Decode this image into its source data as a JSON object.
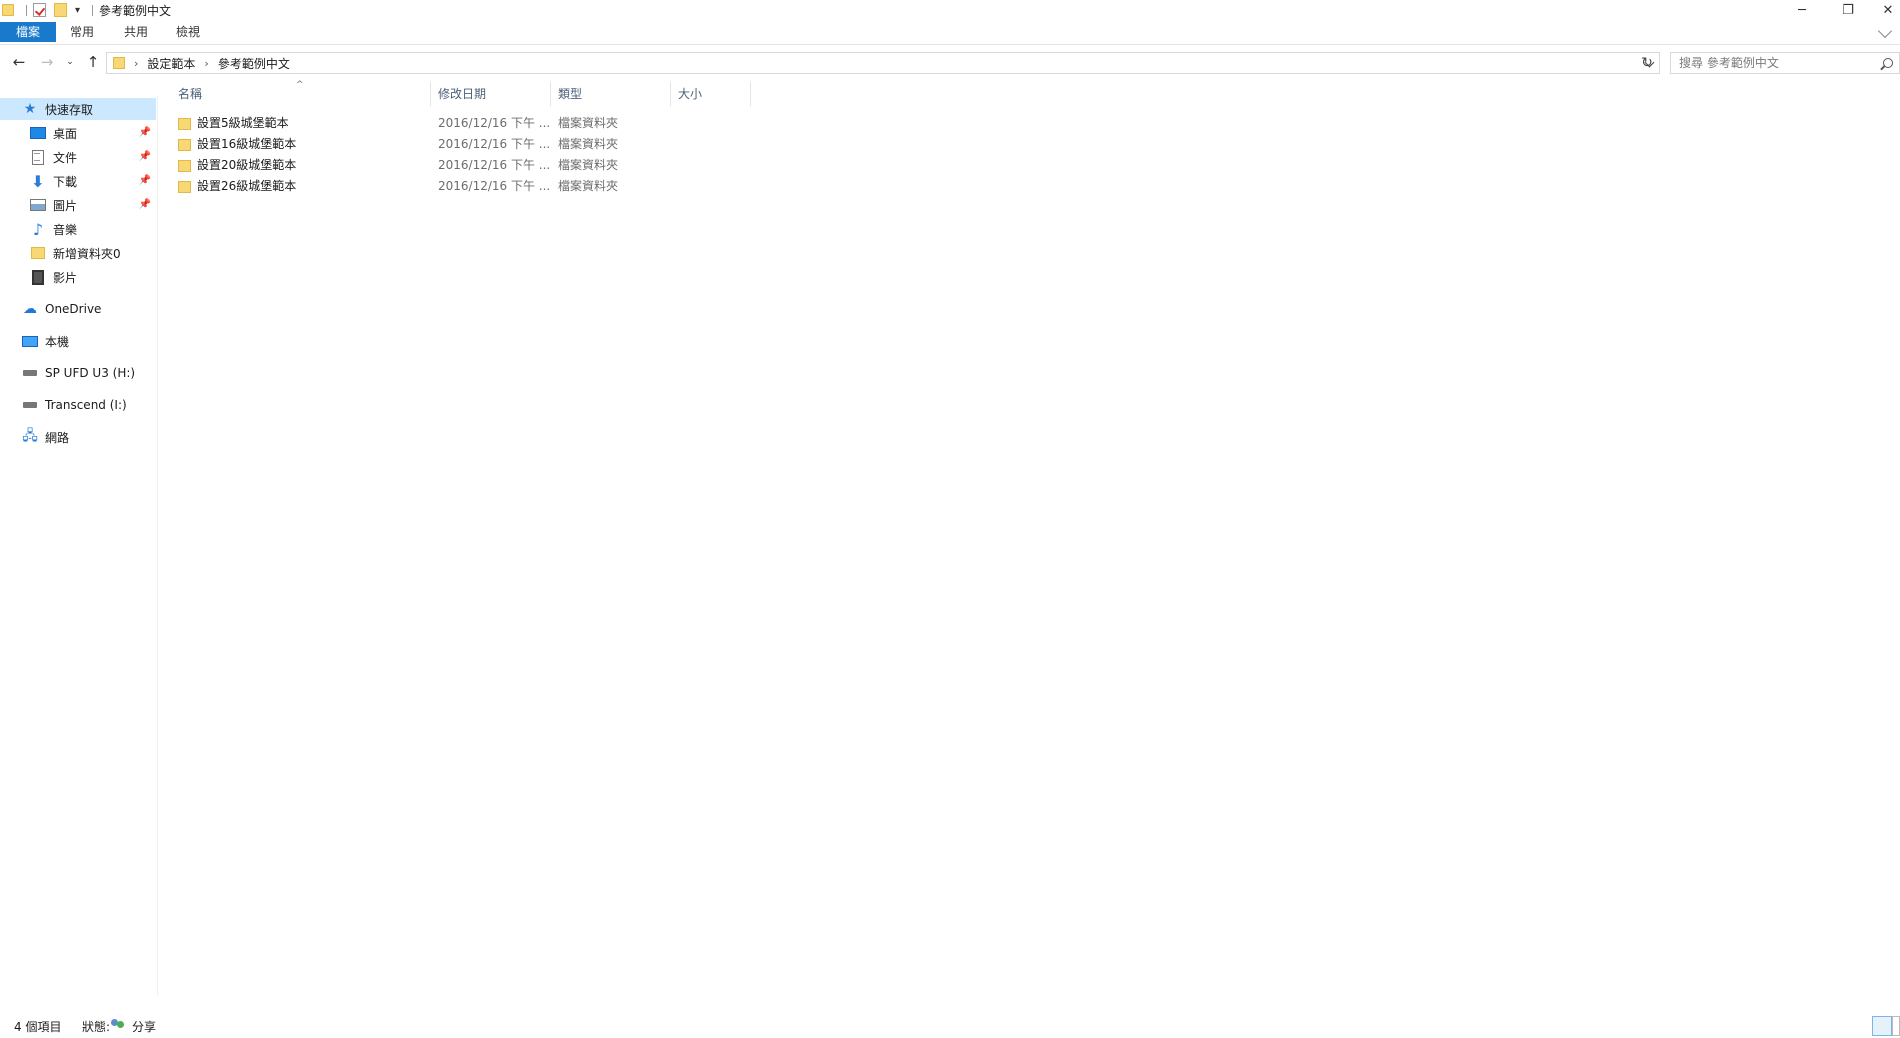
{
  "window": {
    "title": "參考範例中文"
  },
  "ribbon": {
    "tabs": [
      "檔案",
      "常用",
      "共用",
      "檢視"
    ]
  },
  "address": {
    "breadcrumbs": [
      "設定範本",
      "參考範例中文"
    ]
  },
  "search": {
    "placeholder": "搜尋 參考範例中文"
  },
  "sidebar": {
    "quick_access": "快速存取",
    "items": [
      {
        "label": "桌面",
        "icon": "desktop-icon",
        "pinned": true
      },
      {
        "label": "文件",
        "icon": "documents-icon",
        "pinned": true
      },
      {
        "label": "下載",
        "icon": "downloads-icon",
        "pinned": true
      },
      {
        "label": "圖片",
        "icon": "pictures-icon",
        "pinned": true
      },
      {
        "label": "音樂",
        "icon": "music-icon",
        "pinned": false
      },
      {
        "label": "新增資料夾0",
        "icon": "folder-icon",
        "pinned": false
      },
      {
        "label": "影片",
        "icon": "videos-icon",
        "pinned": false
      }
    ],
    "onedrive": "OneDrive",
    "this_pc": "本機",
    "drive_h": "SP UFD U3 (H:)",
    "drive_i": "Transcend (I:)",
    "network": "網路"
  },
  "columns": {
    "name": "名稱",
    "date": "修改日期",
    "type": "類型",
    "size": "大小"
  },
  "files": [
    {
      "name": "設置5級城堡範本",
      "date": "2016/12/16 下午 ...",
      "type": "檔案資料夾"
    },
    {
      "name": "設置16級城堡範本",
      "date": "2016/12/16 下午 ...",
      "type": "檔案資料夾"
    },
    {
      "name": "設置20級城堡範本",
      "date": "2016/12/16 下午 ...",
      "type": "檔案資料夾"
    },
    {
      "name": "設置26級城堡範本",
      "date": "2016/12/16 下午 ...",
      "type": "檔案資料夾"
    }
  ],
  "status": {
    "item_count": "4 個項目",
    "state_label": "狀態:",
    "share_label": "分享"
  },
  "colors": {
    "accent": "#1979ca",
    "selection": "#cce8ff",
    "folder": "#f8d775"
  }
}
